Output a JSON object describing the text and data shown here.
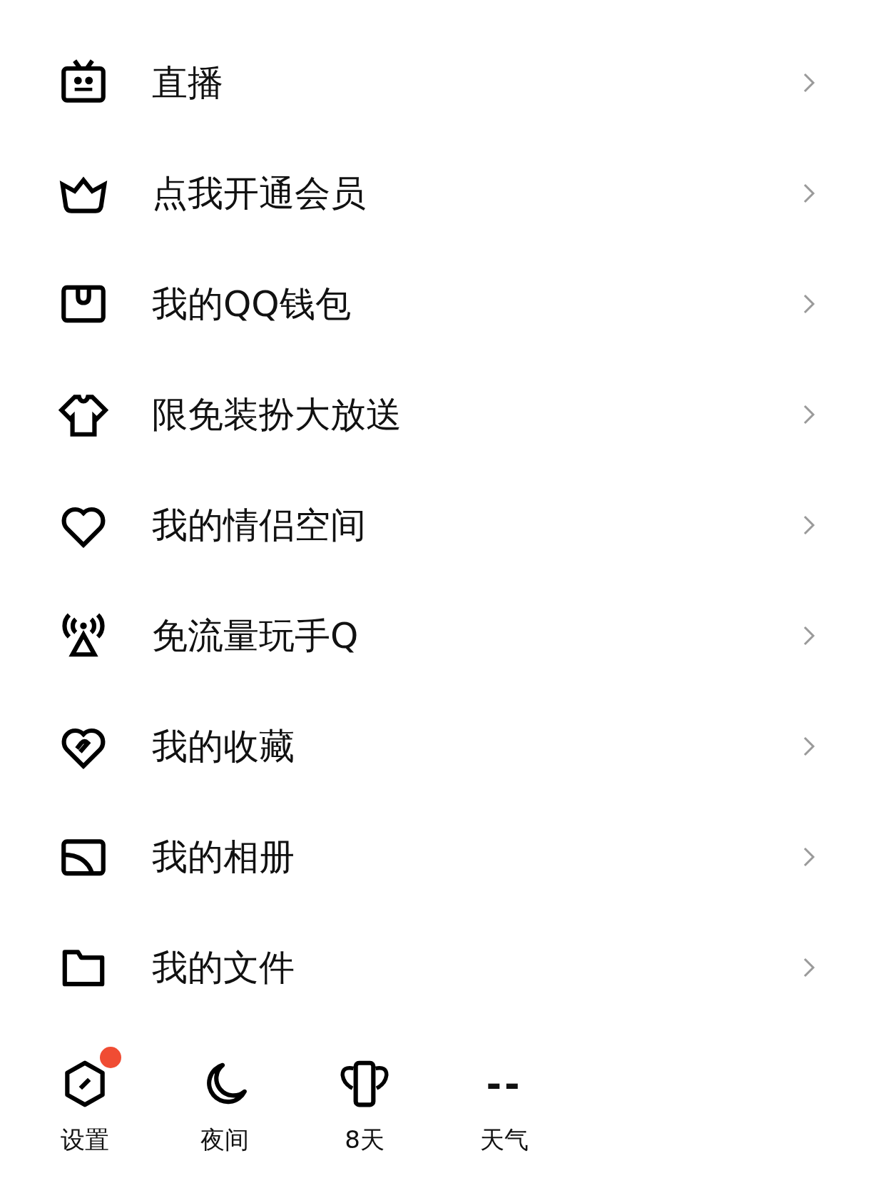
{
  "menu": [
    {
      "label": "直播"
    },
    {
      "label": "点我开通会员"
    },
    {
      "label": "我的QQ钱包"
    },
    {
      "label": "限免装扮大放送"
    },
    {
      "label": "我的情侣空间"
    },
    {
      "label": "免流量玩手Q"
    },
    {
      "label": "我的收藏"
    },
    {
      "label": "我的相册"
    },
    {
      "label": "我的文件"
    }
  ],
  "bottom_bar": [
    {
      "label": "设置",
      "kind": "icon",
      "badge": true
    },
    {
      "label": "夜间",
      "kind": "icon",
      "badge": false
    },
    {
      "label": "8天",
      "kind": "icon",
      "badge": false
    },
    {
      "label": "天气",
      "kind": "value",
      "value": "--",
      "badge": false
    }
  ]
}
